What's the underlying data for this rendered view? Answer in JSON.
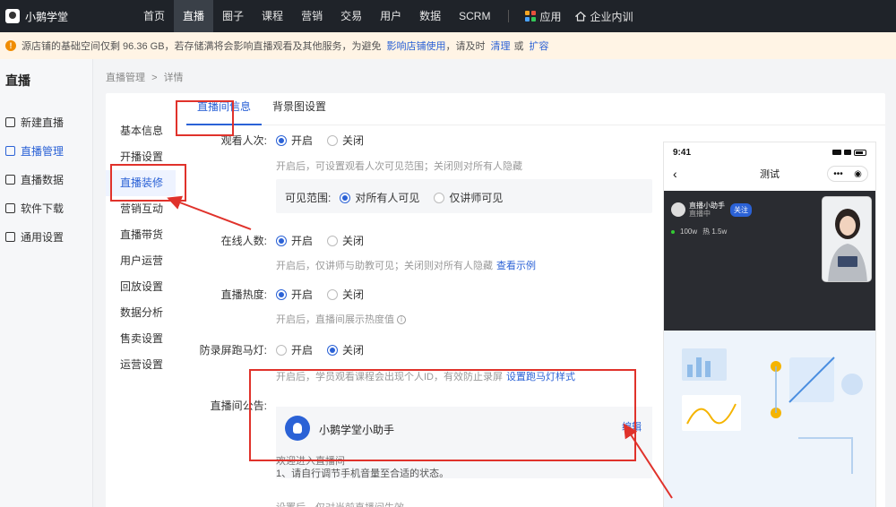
{
  "topnav": {
    "logo_text": "小鹅学堂",
    "items": [
      "首页",
      "直播",
      "圈子",
      "课程",
      "营销",
      "交易",
      "用户",
      "数据",
      "SCRM"
    ],
    "active_index": 1,
    "apps": {
      "app_label": "应用",
      "training_label": "企业内训"
    },
    "grid_colors": [
      "#f5a623",
      "#e84f3d",
      "#4aa3ff",
      "#34c759"
    ]
  },
  "banner": {
    "text": "源店铺的基础空间仅剩 96.36 GB，若存储满将会影响直播观看及其他服务，为避免",
    "link1": "影响店铺使用",
    "text2": "，请及时",
    "link2": "清理",
    "text3": "或",
    "link3": "扩容"
  },
  "sidebar": {
    "title": "直播",
    "items": [
      "新建直播",
      "直播管理",
      "直播数据",
      "软件下载",
      "通用设置"
    ],
    "active_index": 1
  },
  "breadcrumb": {
    "root": "直播管理",
    "sep": ">",
    "current": "详情"
  },
  "subnav": {
    "items": [
      "基本信息",
      "开播设置",
      "直播装修",
      "营销互动",
      "直播带货",
      "用户运营",
      "回放设置",
      "数据分析",
      "售卖设置",
      "运营设置"
    ],
    "active_index": 2
  },
  "tabs": {
    "items": [
      "直播间信息",
      "背景图设置"
    ],
    "active_index": 0
  },
  "form": {
    "viewers": {
      "label": "观看人次:",
      "on": "开启",
      "off": "关闭",
      "hint": "开启后，可设置观看人次可见范围；关闭则对所有人隐藏",
      "scope_label": "可见范围:",
      "scope_all": "对所有人可见",
      "scope_lecturer": "仅讲师可见"
    },
    "online": {
      "label": "在线人数:",
      "on": "开启",
      "off": "关闭",
      "hint": "开启后，仅讲师与助教可见；关闭则对所有人隐藏",
      "hint_link": "查看示例"
    },
    "heat": {
      "label": "直播热度:",
      "on": "开启",
      "off": "关闭",
      "hint": "开启后，直播间展示热度值"
    },
    "marquee": {
      "label": "防录屏跑马灯:",
      "on": "开启",
      "off": "关闭",
      "hint": "开启后，学员观看课程会出现个人ID，有效防止录屏",
      "hint_link": "设置跑马灯样式"
    },
    "notice": {
      "label": "直播间公告:",
      "assistant_name": "小鹅学堂小助手",
      "edit": "编辑",
      "line1": "欢迎进入直播间",
      "line2": "1、请自行调节手机音量至合适的状态。",
      "footer": "设置后，仅对当前直播间生效"
    }
  },
  "phone": {
    "time": "9:41",
    "title": "测试",
    "more": "•••",
    "host_name": "直播小助手",
    "host_sub": "直播中",
    "follow": "关注",
    "stat_views": "100w",
    "stat_hot": "热 1.5w"
  },
  "colors": {
    "accent": "#2b62d6",
    "nav_bg": "#1f2329",
    "annotation_red": "#e0322b",
    "banner_bg": "#fff4e5"
  },
  "icons": {
    "sidebar": [
      "video-plus-icon",
      "list-icon",
      "chart-icon",
      "download-icon",
      "settings-icon"
    ]
  }
}
